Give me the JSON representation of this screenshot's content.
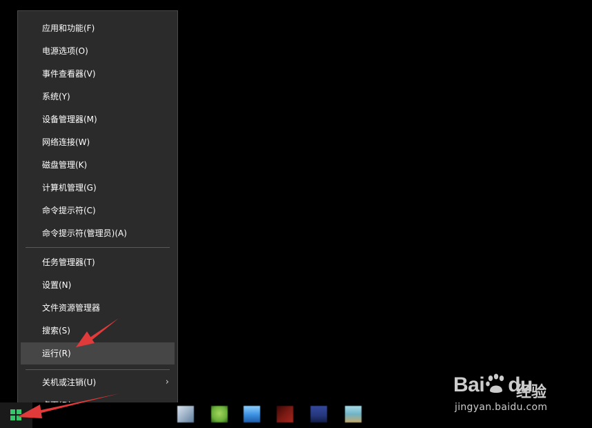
{
  "context_menu": {
    "items": [
      {
        "label": "应用和功能(F)"
      },
      {
        "label": "电源选项(O)"
      },
      {
        "label": "事件查看器(V)"
      },
      {
        "label": "系统(Y)"
      },
      {
        "label": "设备管理器(M)"
      },
      {
        "label": "网络连接(W)"
      },
      {
        "label": "磁盘管理(K)"
      },
      {
        "label": "计算机管理(G)"
      },
      {
        "label": "命令提示符(C)"
      },
      {
        "label": "命令提示符(管理员)(A)"
      },
      {
        "label": "任务管理器(T)"
      },
      {
        "label": "设置(N)"
      },
      {
        "label": "文件资源管理器"
      },
      {
        "label": "搜索(S)"
      },
      {
        "label": "运行(R)",
        "highlighted": true
      },
      {
        "label": "关机或注销(U)",
        "has_submenu": true,
        "chevron_icon": "chevron-right-icon"
      },
      {
        "label": "桌面(D)"
      }
    ]
  },
  "taskbar": {
    "start_icon": "windows-logo-icon",
    "start_color": "#35c86b",
    "pinned_icons": [
      {
        "name": "taskbar-app-icon-1",
        "color": "#9fb3c8"
      },
      {
        "name": "taskbar-app-icon-2",
        "color": "#6ab03a"
      },
      {
        "name": "taskbar-app-icon-3",
        "color": "#3a8fe0"
      },
      {
        "name": "taskbar-app-icon-4",
        "color": "#7a1a14"
      },
      {
        "name": "taskbar-app-icon-5",
        "color": "#25367a"
      },
      {
        "name": "taskbar-app-icon-6",
        "color": "#6fb3c6"
      }
    ]
  },
  "annotations": {
    "arrow_color": "#e03a3a"
  },
  "watermark": {
    "logo_text_left": "Bai",
    "logo_text_right": "du",
    "logo_suffix": "经验",
    "url": "jingyan.baidu.com"
  }
}
